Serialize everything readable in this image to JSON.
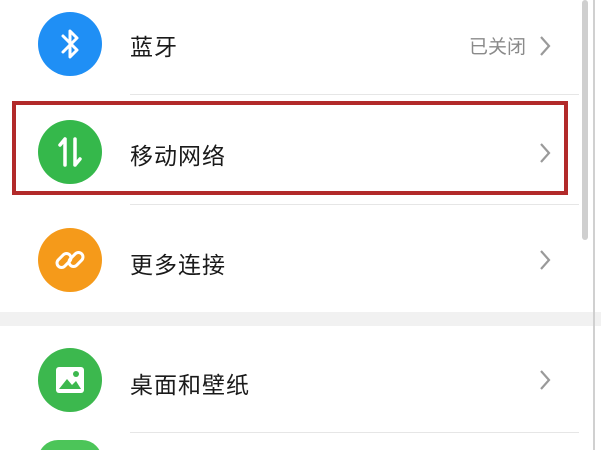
{
  "colors": {
    "bluetooth": "#1f8ff5",
    "mobile_network": "#35b84b",
    "more_connections": "#f59a1a",
    "wallpaper": "#3cb84e",
    "highlight": "#b22a2a"
  },
  "settings": {
    "items": [
      {
        "label": "蓝牙",
        "status": "已关闭",
        "icon": "bluetooth-icon"
      },
      {
        "label": "移动网络",
        "status": "",
        "icon": "arrows-updown-icon"
      },
      {
        "label": "更多连接",
        "status": "",
        "icon": "link-icon"
      },
      {
        "label": "桌面和壁纸",
        "status": "",
        "icon": "image-icon"
      }
    ]
  }
}
